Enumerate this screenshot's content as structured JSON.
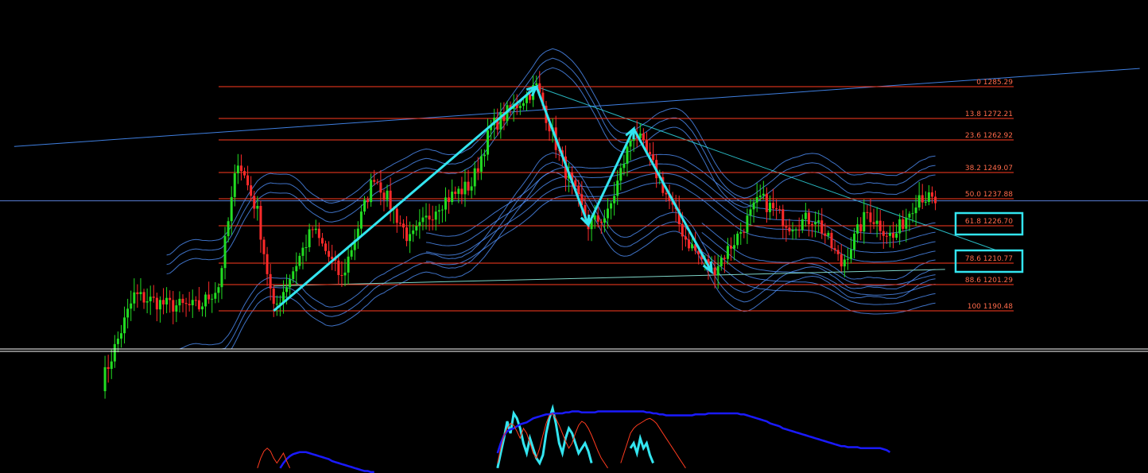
{
  "colors": {
    "background": "#000000",
    "bull_candle": "#22dd22",
    "bear_candle": "#ff2a2a",
    "fib_line": "#ff3b1f",
    "fib_text": "#ff6a4a",
    "zigzag": "#33e5f0",
    "highlight_box": "#33e5f0",
    "envelope": "#4f8ef7",
    "trendline": "#3f7fe0",
    "horizontal_marker": "#5a7fd6",
    "separator": "#ffffff",
    "osc_fast": "#33e5f0",
    "osc_slow": "#1a1aff",
    "osc_mid": "#ff3b1f"
  },
  "chart_data": [
    {
      "type": "candlestick",
      "panel": "price",
      "fibonacci_levels": [
        {
          "label": "0 1285.29",
          "ratio": 0,
          "price": 1285.29,
          "highlighted": false
        },
        {
          "label": "13.8 1272.21",
          "ratio": 13.8,
          "price": 1272.21,
          "highlighted": false
        },
        {
          "label": "23.6 1262.92",
          "ratio": 23.6,
          "price": 1262.92,
          "highlighted": false
        },
        {
          "label": "38.2 1249.07",
          "ratio": 38.2,
          "price": 1249.07,
          "highlighted": false
        },
        {
          "label": "50.0 1237.88",
          "ratio": 50.0,
          "price": 1237.88,
          "highlighted": false
        },
        {
          "label": "61.8 1226.70",
          "ratio": 61.8,
          "price": 1226.7,
          "highlighted": true
        },
        {
          "label": "78.6 1210.77",
          "ratio": 78.6,
          "price": 1210.77,
          "highlighted": true
        },
        {
          "label": "88.6 1201.29",
          "ratio": 88.6,
          "price": 1201.29,
          "highlighted": false
        },
        {
          "label": "100 1190.48",
          "ratio": 100,
          "price": 1190.48,
          "highlighted": false
        }
      ],
      "ylim": [
        1160,
        1320
      ],
      "bars": 300,
      "zigzag_pivots": [
        {
          "bar": 53,
          "price": 1190.48
        },
        {
          "bar": 134,
          "price": 1285.29
        },
        {
          "bar": 150,
          "price": 1226.8
        },
        {
          "bar": 164,
          "price": 1267.5
        },
        {
          "bar": 188,
          "price": 1207.0
        }
      ],
      "anchor_points": [
        {
          "bar": 0,
          "price": 1160
        },
        {
          "bar": 10,
          "price": 1197
        },
        {
          "bar": 20,
          "price": 1193
        },
        {
          "bar": 30,
          "price": 1192
        },
        {
          "bar": 36,
          "price": 1201
        },
        {
          "bar": 42,
          "price": 1255
        },
        {
          "bar": 48,
          "price": 1232
        },
        {
          "bar": 53,
          "price": 1190.48
        },
        {
          "bar": 65,
          "price": 1225
        },
        {
          "bar": 74,
          "price": 1204
        },
        {
          "bar": 84,
          "price": 1248
        },
        {
          "bar": 95,
          "price": 1220
        },
        {
          "bar": 104,
          "price": 1236
        },
        {
          "bar": 114,
          "price": 1244
        },
        {
          "bar": 120,
          "price": 1268
        },
        {
          "bar": 134,
          "price": 1285.29
        },
        {
          "bar": 142,
          "price": 1253
        },
        {
          "bar": 150,
          "price": 1226.8
        },
        {
          "bar": 156,
          "price": 1231
        },
        {
          "bar": 164,
          "price": 1267.5
        },
        {
          "bar": 172,
          "price": 1246
        },
        {
          "bar": 180,
          "price": 1221
        },
        {
          "bar": 188,
          "price": 1207.0
        },
        {
          "bar": 196,
          "price": 1222
        },
        {
          "bar": 203,
          "price": 1238
        },
        {
          "bar": 212,
          "price": 1227
        },
        {
          "bar": 220,
          "price": 1230
        },
        {
          "bar": 228,
          "price": 1210
        },
        {
          "bar": 236,
          "price": 1232
        },
        {
          "bar": 244,
          "price": 1221
        },
        {
          "bar": 252,
          "price": 1240
        },
        {
          "bar": 257,
          "price": 1236
        }
      ],
      "upper_trendline": [
        {
          "bar": -27,
          "price": 1260
        },
        {
          "bar": 320,
          "price": 1293
        }
      ],
      "falling_trendline": [
        {
          "bar": 134,
          "price": 1285.29
        },
        {
          "bar": 276,
          "price": 1216
        }
      ],
      "support_line": [
        {
          "bar": 53,
          "price": 1201
        },
        {
          "bar": 260,
          "price": 1208
        }
      ],
      "horizontal_marker_price": 1237
    },
    {
      "type": "line",
      "panel": "oscillator",
      "series": [
        {
          "color": "osc_fast",
          "values": [
            0,
            0,
            0,
            0,
            0,
            0,
            0,
            0,
            0,
            0,
            0,
            0,
            0,
            0,
            0,
            0,
            0,
            0,
            0,
            0,
            0,
            0,
            0,
            0,
            0,
            0,
            0,
            0,
            0,
            0,
            0,
            0,
            0,
            0,
            0,
            0,
            0,
            0,
            0,
            0,
            0,
            0,
            0,
            0,
            0,
            0,
            0,
            0,
            0,
            0,
            0,
            0,
            0,
            0,
            0,
            0,
            0,
            0,
            0,
            0,
            0,
            0,
            0,
            0,
            0,
            0,
            0,
            0,
            0,
            0,
            0,
            0,
            0,
            0,
            0,
            0,
            0,
            0,
            0,
            0,
            0,
            0,
            0,
            0,
            0,
            0,
            0,
            0,
            0,
            0,
            0,
            0,
            0,
            0,
            0,
            0,
            0,
            0,
            0,
            0,
            0,
            0,
            0,
            0,
            0,
            0,
            0,
            0,
            0,
            0,
            0,
            0,
            0,
            0,
            0,
            0,
            0,
            0,
            0,
            0,
            0,
            0,
            5,
            20,
            35,
            52,
            40,
            60,
            55,
            45,
            30,
            20,
            35,
            25,
            15,
            10,
            18,
            40,
            55,
            65,
            50,
            30,
            20,
            35,
            45,
            40,
            30,
            20,
            25,
            30,
            22,
            10,
            0,
            0,
            0,
            0,
            0,
            0,
            0,
            0,
            0,
            0,
            0,
            25,
            30,
            20,
            35,
            25,
            30,
            18,
            10,
            0,
            0,
            0,
            0,
            0,
            0,
            0,
            0,
            0,
            0,
            0,
            0,
            0,
            0,
            0,
            0,
            0,
            0,
            0,
            0,
            0,
            0,
            0,
            0,
            0,
            0,
            0,
            0,
            0,
            0,
            0,
            0,
            0,
            0,
            0,
            0,
            0,
            0,
            0,
            0,
            0,
            0,
            0,
            0,
            0,
            0,
            0,
            0,
            0,
            0,
            0,
            0,
            0,
            0,
            0,
            0,
            0,
            0,
            0,
            0,
            0,
            0,
            0,
            0,
            0,
            0,
            0,
            0,
            0,
            0,
            0,
            0,
            0,
            0,
            0,
            0,
            0,
            0,
            0,
            0,
            0,
            0,
            0,
            0,
            0,
            0,
            0,
            0,
            0,
            0,
            0,
            0,
            0,
            0,
            0,
            0,
            0,
            0,
            0,
            0,
            0,
            0,
            0,
            0,
            0,
            0,
            0,
            0,
            0,
            0,
            0,
            0,
            0,
            0,
            0,
            0
          ]
        },
        {
          "color": "osc_slow",
          "values": [
            0,
            0,
            0,
            0,
            0,
            0,
            0,
            0,
            0,
            0,
            0,
            0,
            0,
            0,
            0,
            0,
            0,
            0,
            0,
            0,
            0,
            0,
            0,
            0,
            0,
            0,
            0,
            0,
            0,
            0,
            0,
            0,
            0,
            0,
            0,
            0,
            0,
            0,
            0,
            0,
            0,
            0,
            0,
            0,
            0,
            0,
            0,
            0,
            0,
            0,
            0,
            0,
            0,
            0,
            0,
            5,
            10,
            14,
            17,
            19,
            20,
            21,
            21,
            21,
            20,
            19,
            18,
            17,
            16,
            15,
            14,
            12,
            11,
            10,
            9,
            8,
            7,
            6,
            5,
            4,
            3,
            2,
            2,
            1,
            1,
            0,
            0,
            0,
            0,
            0,
            0,
            0,
            0,
            0,
            0,
            0,
            0,
            0,
            0,
            0,
            0,
            0,
            0,
            0,
            0,
            0,
            0,
            0,
            0,
            0,
            0,
            0,
            0,
            0,
            0,
            0,
            0,
            0,
            0,
            0,
            0,
            0,
            20,
            30,
            38,
            42,
            44,
            45,
            47,
            49,
            50,
            51,
            53,
            55,
            56,
            57,
            58,
            59,
            59,
            60,
            60,
            60,
            60,
            61,
            61,
            62,
            62,
            62,
            61,
            61,
            61,
            61,
            61,
            62,
            62,
            62,
            62,
            62,
            62,
            62,
            62,
            62,
            62,
            62,
            62,
            62,
            62,
            62,
            61,
            61,
            60,
            60,
            59,
            59,
            58,
            58,
            58,
            58,
            58,
            58,
            58,
            58,
            58,
            59,
            59,
            59,
            59,
            60,
            60,
            60,
            60,
            60,
            60,
            60,
            60,
            60,
            60,
            59,
            59,
            58,
            57,
            56,
            55,
            54,
            53,
            52,
            50,
            49,
            48,
            47,
            45,
            44,
            43,
            42,
            41,
            40,
            39,
            38,
            37,
            36,
            35,
            34,
            33,
            32,
            31,
            30,
            29,
            28,
            27,
            27,
            26,
            26,
            26,
            26,
            25,
            25,
            25,
            25,
            25,
            25,
            25,
            24,
            23,
            21,
            0,
            0,
            0,
            0,
            0,
            0,
            0,
            0,
            0,
            0,
            0,
            0,
            0,
            0,
            0,
            0,
            0,
            0,
            0,
            0,
            0,
            0,
            0,
            0,
            0,
            0,
            0,
            0,
            0,
            0,
            0,
            0,
            0,
            0,
            0,
            0,
            0,
            0,
            0,
            0,
            0,
            0,
            0,
            0,
            0,
            0,
            0,
            0,
            0,
            0,
            0,
            0,
            0
          ]
        },
        {
          "color": "osc_mid",
          "values": [
            0,
            0,
            0,
            0,
            0,
            0,
            0,
            0,
            0,
            0,
            0,
            0,
            0,
            0,
            0,
            0,
            0,
            0,
            0,
            0,
            0,
            0,
            0,
            0,
            0,
            0,
            0,
            0,
            0,
            0,
            0,
            0,
            0,
            0,
            0,
            0,
            0,
            0,
            0,
            0,
            0,
            0,
            0,
            0,
            0,
            0,
            0,
            0,
            5,
            15,
            22,
            25,
            22,
            15,
            10,
            15,
            20,
            12,
            5,
            0,
            0,
            0,
            0,
            0,
            0,
            0,
            0,
            0,
            0,
            0,
            0,
            0,
            0,
            0,
            0,
            0,
            0,
            0,
            0,
            0,
            0,
            0,
            0,
            0,
            0,
            0,
            0,
            0,
            0,
            0,
            0,
            0,
            0,
            0,
            0,
            0,
            0,
            0,
            0,
            0,
            0,
            0,
            0,
            0,
            0,
            0,
            0,
            0,
            0,
            0,
            0,
            0,
            0,
            0,
            0,
            0,
            0,
            0,
            0,
            0,
            0,
            0,
            10,
            25,
            38,
            45,
            50,
            48,
            42,
            35,
            45,
            40,
            30,
            20,
            15,
            25,
            38,
            50,
            58,
            60,
            55,
            48,
            40,
            32,
            25,
            30,
            40,
            48,
            52,
            50,
            45,
            38,
            30,
            22,
            15,
            10,
            5,
            0,
            0,
            0,
            10,
            20,
            30,
            40,
            45,
            48,
            50,
            52,
            54,
            55,
            53,
            50,
            45,
            40,
            35,
            30,
            25,
            20,
            15,
            10,
            5,
            0,
            0,
            0,
            0,
            0,
            0,
            0,
            0,
            0,
            0,
            0,
            0,
            0,
            0,
            0,
            0,
            0,
            0,
            0,
            0,
            0,
            0,
            0,
            0,
            0,
            0,
            0,
            0,
            0,
            0,
            0,
            0,
            0,
            0,
            0,
            0,
            0,
            0,
            0,
            0,
            0,
            0,
            0,
            0,
            0,
            0,
            0,
            0,
            0,
            0,
            0,
            0,
            0,
            0,
            0,
            0,
            0,
            0,
            0,
            0,
            0,
            0,
            0,
            0,
            0,
            0,
            0,
            0,
            0,
            0,
            0,
            0,
            0,
            0,
            0,
            0,
            0,
            0,
            0,
            0,
            0,
            0,
            0,
            0,
            0,
            0,
            0,
            0,
            0,
            0,
            0,
            0,
            0,
            0,
            0,
            0,
            0,
            0,
            0,
            0,
            0,
            0,
            0,
            0
          ]
        }
      ],
      "ylim": [
        0,
        100
      ]
    }
  ]
}
